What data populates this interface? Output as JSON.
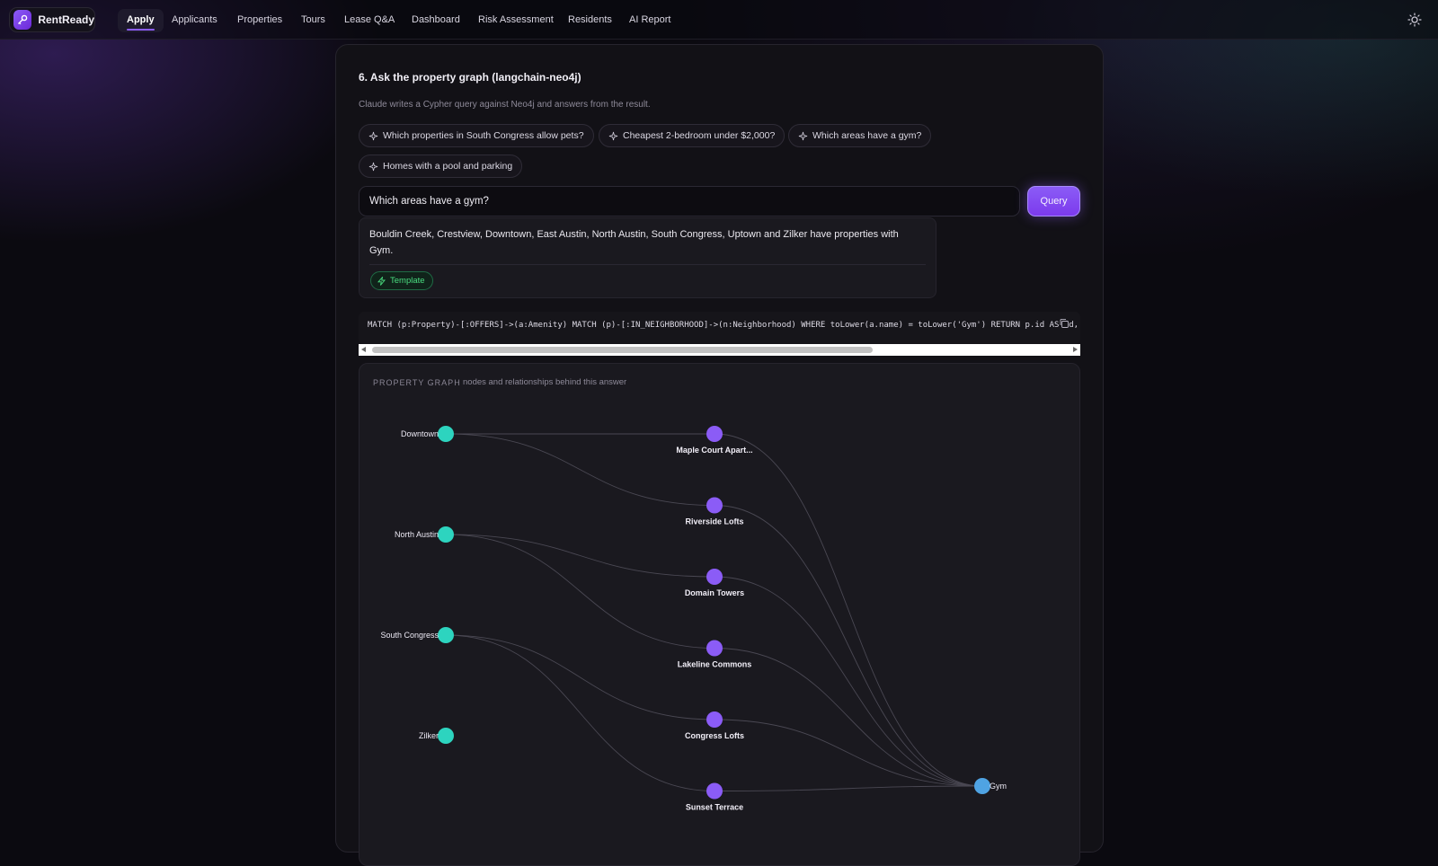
{
  "app": {
    "brand": "RentReady",
    "nav": [
      "Apply",
      "Applicants",
      "Properties",
      "Tours",
      "Lease Q&A",
      "Dashboard",
      "Risk Assessment",
      "Residents",
      "AI Report"
    ],
    "active_nav": "Apply",
    "theme_icon": "sun-icon"
  },
  "section": {
    "title": "6. Ask the property graph (langchain-neo4j)",
    "subtitle": "Claude writes a Cypher query against Neo4j and answers from the result.",
    "suggestions": [
      "Which properties in South Congress allow pets?",
      "Cheapest 2-bedroom under $2,000?",
      "Which areas have a gym?",
      "Homes with a pool and parking"
    ],
    "suggestion_icon": "sparkle-icon"
  },
  "query": {
    "value": "Which areas have a gym?",
    "button": "Query"
  },
  "answer": {
    "text": "Bouldin Creek, Crestview, Downtown, East Austin, North Austin, South Congress, Uptown and Zilker have properties with Gym.",
    "badge": "Template",
    "badge_icon": "lightning-icon"
  },
  "cypher": "MATCH (p:Property)-[:OFFERS]->(a:Amenity) MATCH (p)-[:IN_NEIGHBORHOOD]->(n:Neighborhood) WHERE toLower(a.name) = toLower('Gym') RETURN p.id AS id, p.name",
  "graph": {
    "label": "PROPERTY GRAPH",
    "sublabel": "nodes and relationships behind this answer",
    "neighborhoods": [
      "Downtown",
      "North Austin",
      "South Congress",
      "Zilker"
    ],
    "properties": [
      "Maple Court Apart...",
      "Riverside Lofts",
      "Domain Towers",
      "Lakeline Commons",
      "Congress Lofts",
      "Sunset Terrace"
    ],
    "amenity": "Gym",
    "colors": {
      "neighborhood": "#2dd4bf",
      "property": "#8b5cf6",
      "amenity": "#4fa3e3",
      "edge": "#4a4853"
    },
    "edges": [
      [
        "Downtown",
        "Maple Court Apart..."
      ],
      [
        "Downtown",
        "Riverside Lofts"
      ],
      [
        "North Austin",
        "Domain Towers"
      ],
      [
        "North Austin",
        "Lakeline Commons"
      ],
      [
        "South Congress",
        "Congress Lofts"
      ],
      [
        "South Congress",
        "Sunset Terrace"
      ],
      [
        "Maple Court Apart...",
        "Gym"
      ],
      [
        "Riverside Lofts",
        "Gym"
      ],
      [
        "Domain Towers",
        "Gym"
      ],
      [
        "Lakeline Commons",
        "Gym"
      ],
      [
        "Congress Lofts",
        "Gym"
      ],
      [
        "Sunset Terrace",
        "Gym"
      ]
    ]
  }
}
